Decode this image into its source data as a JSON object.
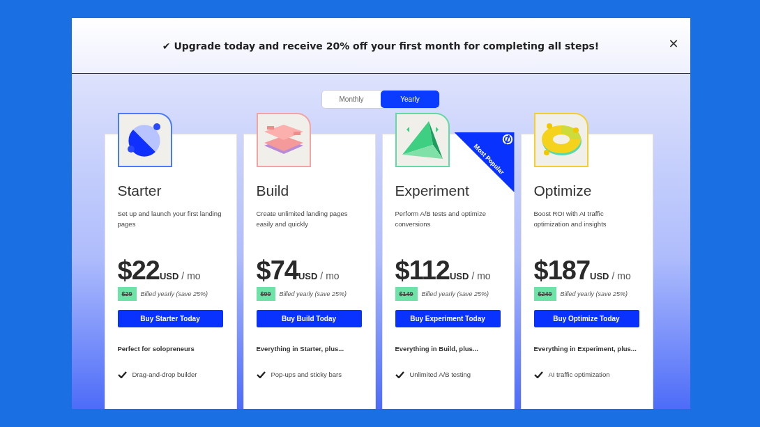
{
  "banner": {
    "text": "✔ Upgrade today and receive 20% off your first month for completing all steps!",
    "close": "✕"
  },
  "billing_toggle": [
    {
      "label": "Monthly",
      "selected": false
    },
    {
      "label": "Yearly",
      "selected": true
    }
  ],
  "plans": [
    {
      "name": "Starter",
      "color": "#4a7cf7",
      "description": "Set up and launch your first landing pages",
      "price": "$22",
      "currency": "USD",
      "period": "/ mo",
      "old_price": "$29",
      "billing_note": "Billed yearly (save 25%)",
      "button": "Buy Starter Today",
      "features_heading": "Perfect for solopreneurs",
      "features": [
        "Drag-and-drop builder"
      ]
    },
    {
      "name": "Build",
      "color": "#f4a3a3",
      "description": "Create unlimited landing pages easily and quickly",
      "price": "$74",
      "currency": "USD",
      "period": "/ mo",
      "old_price": "$99",
      "billing_note": "Billed yearly (save 25%)",
      "button": "Buy Build Today",
      "features_heading": "Everything in Starter, plus...",
      "features": [
        "Pop-ups and sticky bars"
      ]
    },
    {
      "name": "Experiment",
      "color": "#63d9a6",
      "ribbon": "Most Popular",
      "description": "Perform A/B tests and optimize conversions",
      "price": "$112",
      "currency": "USD",
      "period": "/ mo",
      "old_price": "$149",
      "billing_note": "Billed yearly (save 25%)",
      "button": "Buy Experiment Today",
      "features_heading": "Everything in Build, plus...",
      "features": [
        "Unlimited A/B testing"
      ]
    },
    {
      "name": "Optimize",
      "color": "#f2cf2e",
      "description": "Boost ROI with AI traffic optimization and insights",
      "price": "$187",
      "currency": "USD",
      "period": "/ mo",
      "old_price": "$249",
      "billing_note": "Billed yearly (save 25%)",
      "button": "Buy Optimize Today",
      "features_heading": "Everything in Experiment, plus...",
      "features": [
        "AI traffic optimization"
      ]
    }
  ]
}
